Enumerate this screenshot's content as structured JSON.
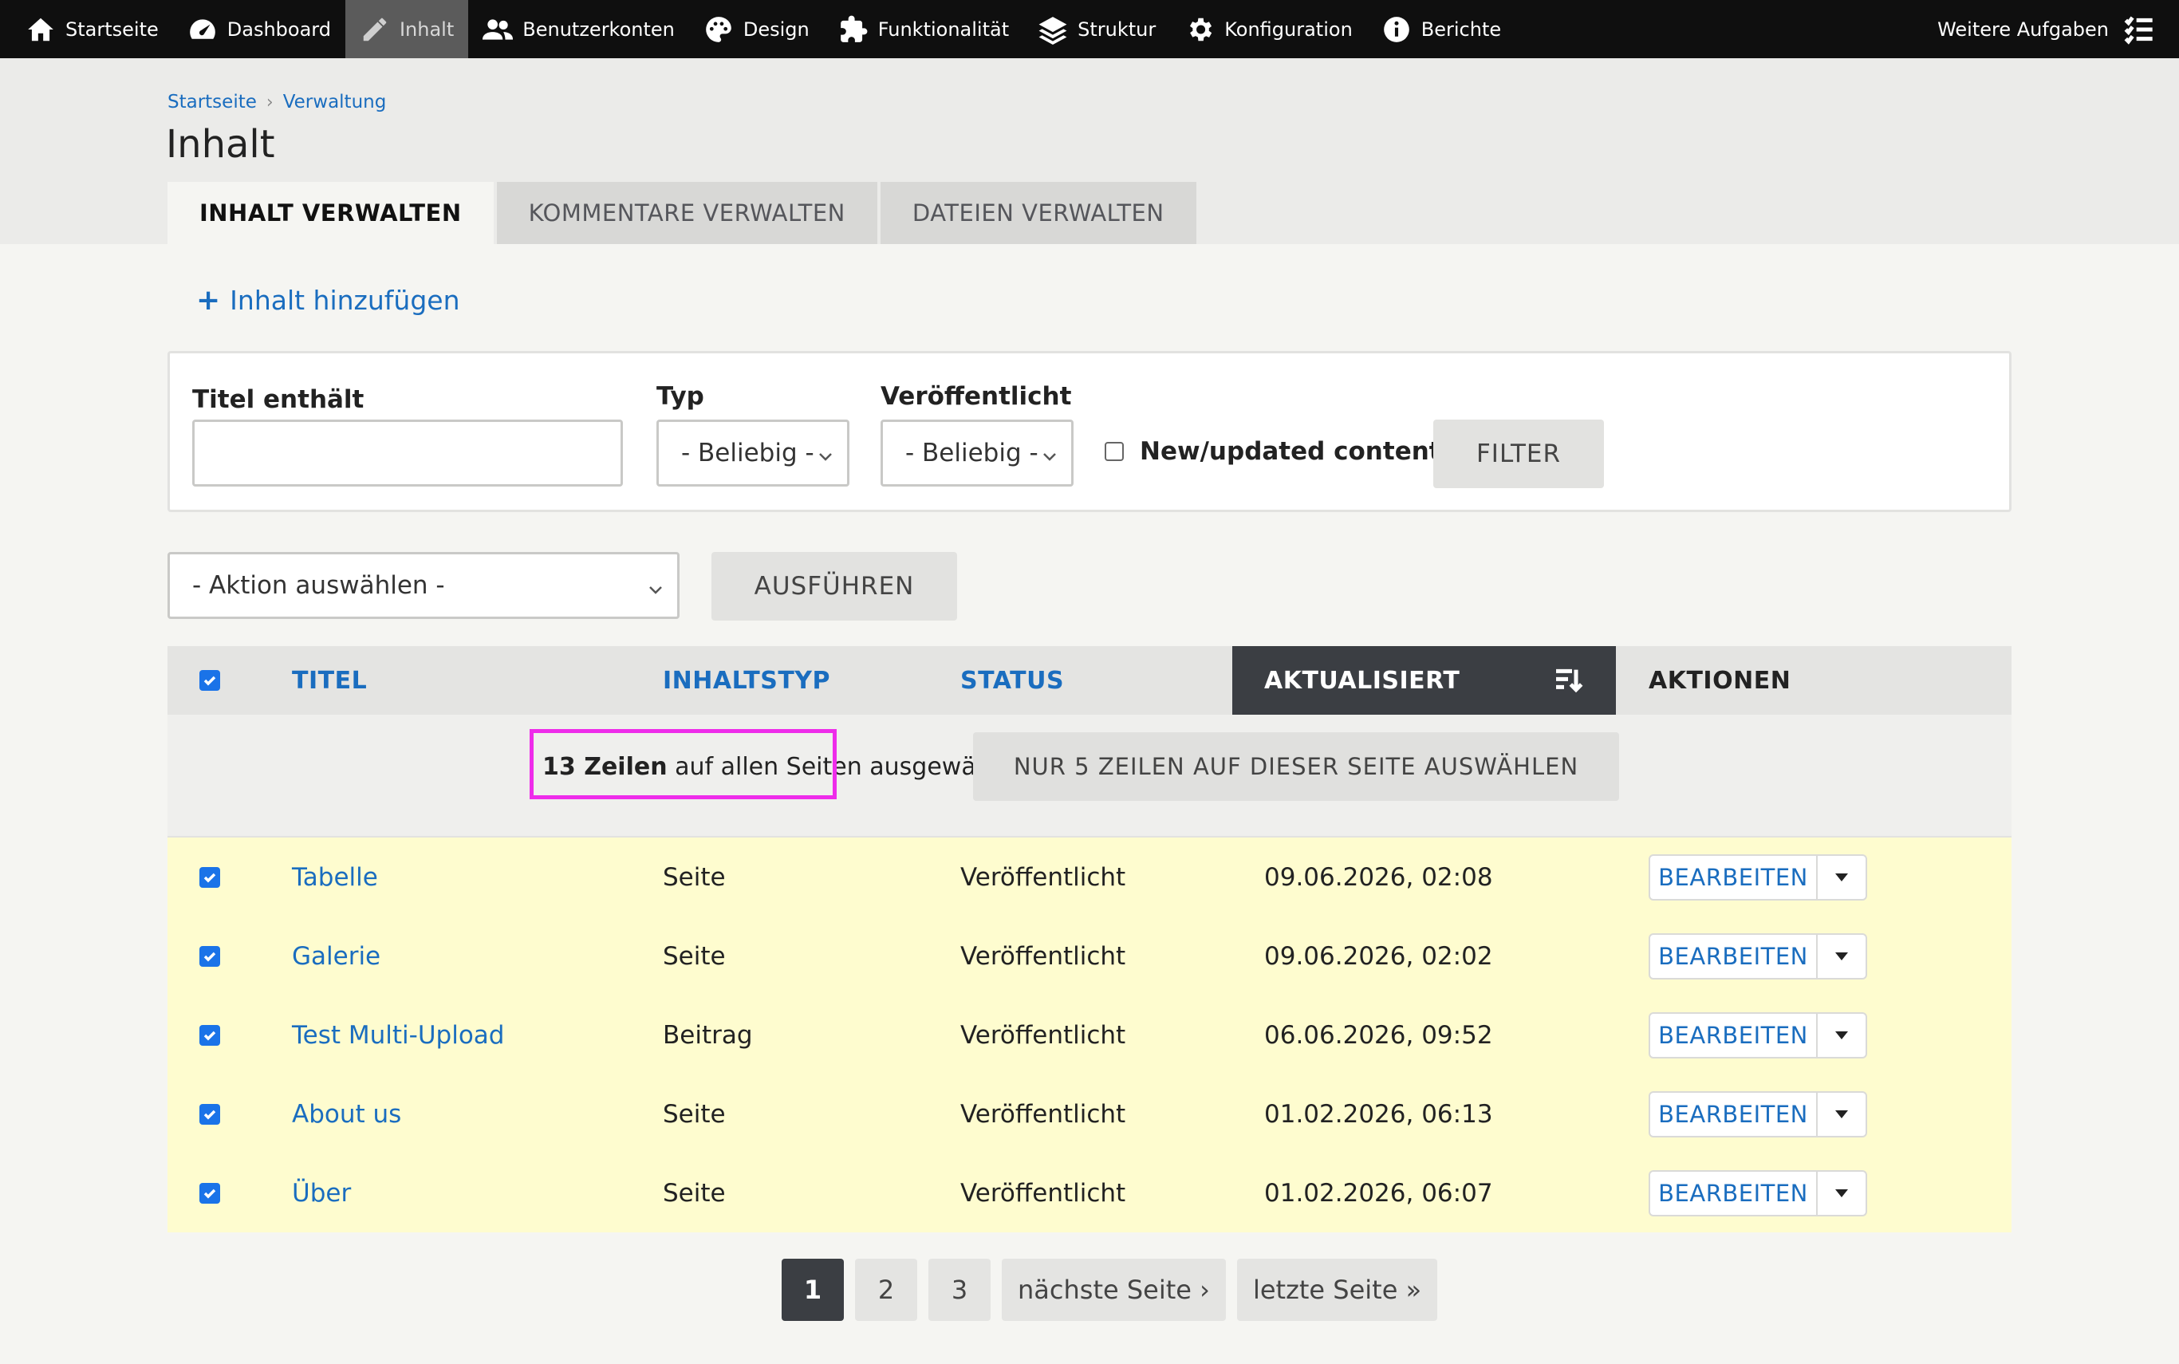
{
  "toolbar": {
    "items": [
      {
        "label": "Startseite",
        "icon": "home-icon"
      },
      {
        "label": "Dashboard",
        "icon": "speedometer-icon"
      },
      {
        "label": "Inhalt",
        "icon": "pencil-icon",
        "active": true
      },
      {
        "label": "Benutzerkonten",
        "icon": "users-icon"
      },
      {
        "label": "Design",
        "icon": "palette-icon"
      },
      {
        "label": "Funktionalität",
        "icon": "puzzle-icon"
      },
      {
        "label": "Struktur",
        "icon": "layers-icon"
      },
      {
        "label": "Konfiguration",
        "icon": "gear-icon"
      },
      {
        "label": "Berichte",
        "icon": "info-icon"
      }
    ],
    "more_tasks": "Weitere Aufgaben"
  },
  "breadcrumb": [
    "Startseite",
    "Verwaltung"
  ],
  "page_title": "Inhalt",
  "tabs": [
    "INHALT VERWALTEN",
    "KOMMENTARE VERWALTEN",
    "DATEIEN VERWALTEN"
  ],
  "add_content": "Inhalt hinzufügen",
  "filters": {
    "title_label": "Titel enthält",
    "title_value": "",
    "type_label": "Typ",
    "type_value": "- Beliebig -",
    "published_label": "Veröffentlicht",
    "published_value": "- Beliebig -",
    "new_updated_label": "New/updated content",
    "filter_button": "FILTER"
  },
  "bulk": {
    "action_value": "- Aktion auswählen -",
    "execute_button": "AUSFÜHREN"
  },
  "table": {
    "headers": {
      "title": "TITEL",
      "type": "INHALTSTYP",
      "status": "STATUS",
      "updated": "AKTUALISIERT",
      "actions": "AKTIONEN"
    },
    "selection": {
      "count": "13 Zeilen",
      "scope": " auf allen Seiten ",
      "suffix": "ausgewählt.",
      "button": "NUR 5 ZEILEN AUF DIESER SEITE AUSWÄHLEN"
    },
    "rows": [
      {
        "title": "Tabelle",
        "type": "Seite",
        "status": "Veröffentlicht",
        "updated": "09.06.2026, 02:08",
        "action": "BEARBEITEN"
      },
      {
        "title": "Galerie",
        "type": "Seite",
        "status": "Veröffentlicht",
        "updated": "09.06.2026, 02:02",
        "action": "BEARBEITEN"
      },
      {
        "title": "Test Multi-Upload",
        "type": "Beitrag",
        "status": "Veröffentlicht",
        "updated": "06.06.2026, 09:52",
        "action": "BEARBEITEN"
      },
      {
        "title": "About us",
        "type": "Seite",
        "status": "Veröffentlicht",
        "updated": "01.02.2026, 06:13",
        "action": "BEARBEITEN"
      },
      {
        "title": "Über",
        "type": "Seite",
        "status": "Veröffentlicht",
        "updated": "01.02.2026, 06:07",
        "action": "BEARBEITEN"
      }
    ]
  },
  "pager": {
    "pages": [
      "1",
      "2",
      "3"
    ],
    "current": "1",
    "next": "nächste Seite ›",
    "last": "letzte Seite »"
  },
  "colors": {
    "link": "#1a6dbf",
    "toolbar_bg": "#0f0f0f",
    "selected_row_bg": "#fefccf",
    "highlight_border": "#ee2cea",
    "sorted_header_bg": "#3b3e43"
  }
}
